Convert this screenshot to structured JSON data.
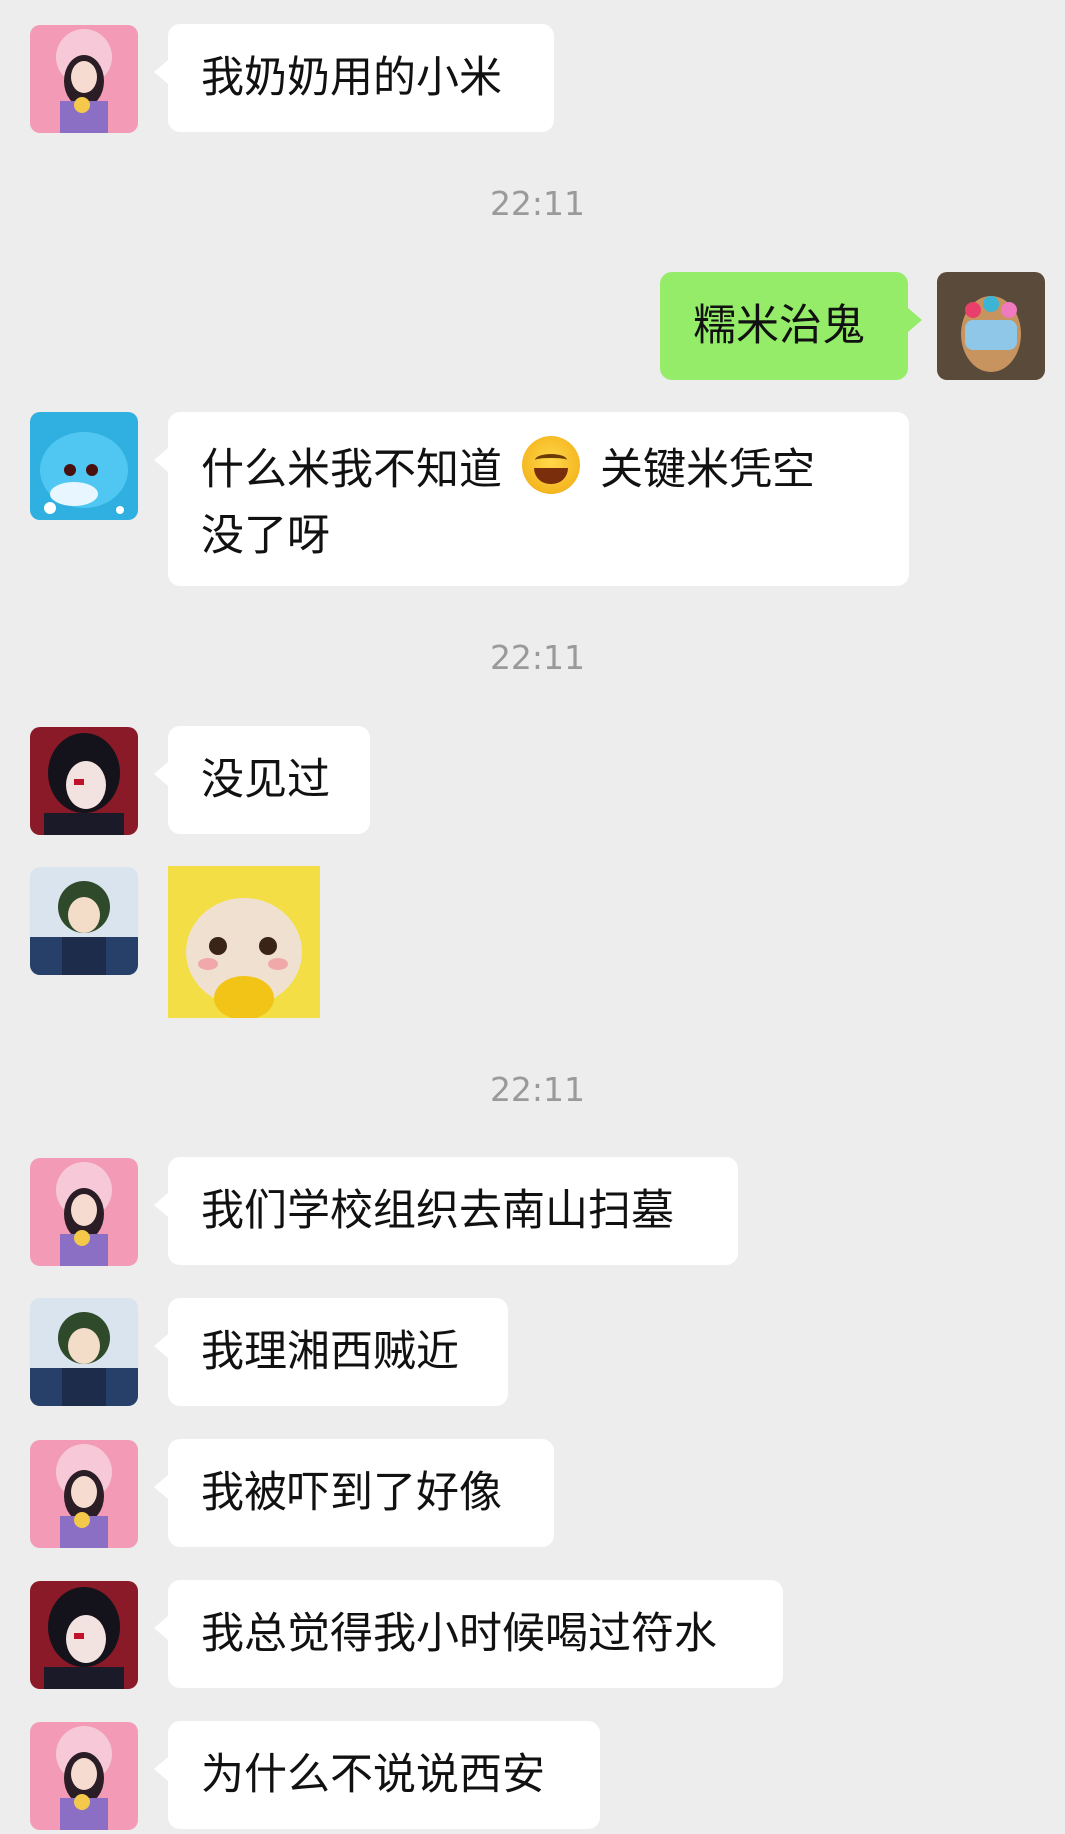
{
  "messages": [
    {
      "id": "m1",
      "text": "我奶奶用的小米"
    },
    {
      "id": "ts1",
      "time": "22:11"
    },
    {
      "id": "m2",
      "text": "糯米治鬼"
    },
    {
      "id": "m3",
      "text_a": "什么米我不知道",
      "text_b": "关键米凭空",
      "text_c": "没了呀"
    },
    {
      "id": "ts2",
      "time": "22:11"
    },
    {
      "id": "m4",
      "text": "没见过"
    },
    {
      "id": "m5",
      "sticker": "teletubby-sticker"
    },
    {
      "id": "ts3",
      "time": "22:11"
    },
    {
      "id": "m6",
      "text": "我们学校组织去南山扫墓"
    },
    {
      "id": "m7",
      "text": "我理湘西贼近"
    },
    {
      "id": "m8",
      "text": "我被吓到了好像"
    },
    {
      "id": "m9",
      "text": "我总觉得我小时候喝过符水"
    },
    {
      "id": "m10",
      "text": "为什么不说说西安"
    }
  ],
  "colors": {
    "background": "#ededed",
    "bubble_other": "#ffffff",
    "bubble_mine": "#95ec69",
    "timestamp": "#9a9a9a"
  },
  "icons": {
    "emoji": "tears-of-joy-emoji"
  }
}
